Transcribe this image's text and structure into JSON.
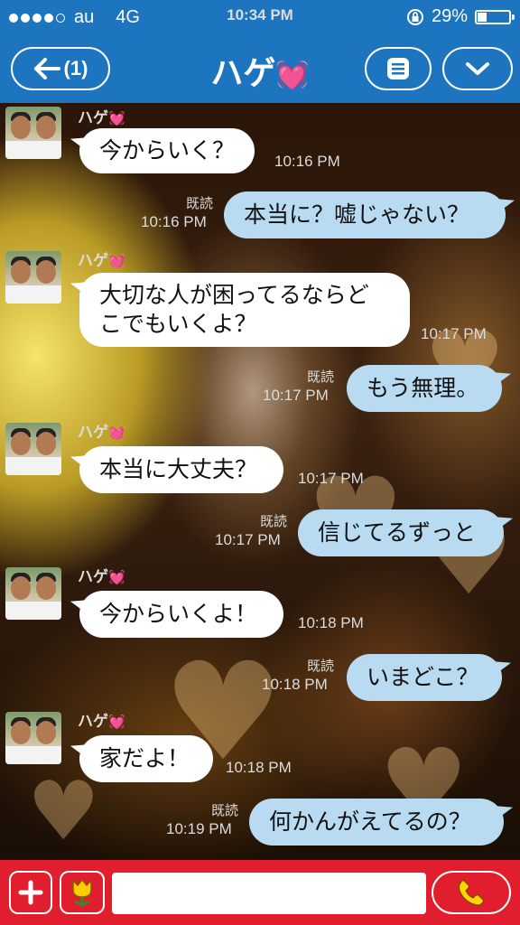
{
  "status_bar": {
    "carrier": "au",
    "network": "4G",
    "time": "10:34 PM",
    "battery": "29%",
    "battery_level": 0.29,
    "signal_bars": 4
  },
  "header": {
    "back_label": "(1)",
    "title": "ハゲ",
    "title_emoji": "💓"
  },
  "chat": {
    "sender_name": "ハゲ",
    "sender_emoji": "💓",
    "read_label": "既読",
    "messages": [
      {
        "dir": "recv",
        "text": "今からいく？",
        "time": "10:16 PM"
      },
      {
        "dir": "sent",
        "text": "本当に？嘘じゃない？",
        "time": "10:16 PM",
        "read": "既読"
      },
      {
        "dir": "recv",
        "text": "大切な人が困ってるならどこでもいくよ？",
        "time": "10:17 PM"
      },
      {
        "dir": "sent",
        "text": "もう無理。",
        "time": "10:17 PM",
        "read": "既読"
      },
      {
        "dir": "recv",
        "text": "本当に大丈夫？",
        "time": "10:17 PM"
      },
      {
        "dir": "sent",
        "text": "信じてるずっと",
        "time": "10:17 PM",
        "read": "既読"
      },
      {
        "dir": "recv",
        "text": "今からいくよ！",
        "time": "10:18 PM"
      },
      {
        "dir": "sent",
        "text": "いまどこ？",
        "time": "10:18 PM",
        "read": "既読"
      },
      {
        "dir": "recv",
        "text": "家だよ！",
        "time": "10:18 PM"
      },
      {
        "dir": "sent",
        "text": "何かんがえてるの？",
        "time": "10:19 PM",
        "read": "既読"
      }
    ]
  },
  "input": {
    "placeholder": "",
    "value": ""
  },
  "icons": {
    "back": "arrow-left-icon",
    "menu": "list-menu-icon",
    "more": "chevron-down-icon",
    "add": "plus-icon",
    "sticker": "tulip-sticker-icon",
    "call": "phone-icon"
  },
  "colors": {
    "header": "#1e75bf",
    "bottom_bar": "#e01e2e",
    "sent_bubble": "#b9dbf2",
    "recv_bubble": "#ffffff",
    "heart": "#ff4fa3"
  }
}
